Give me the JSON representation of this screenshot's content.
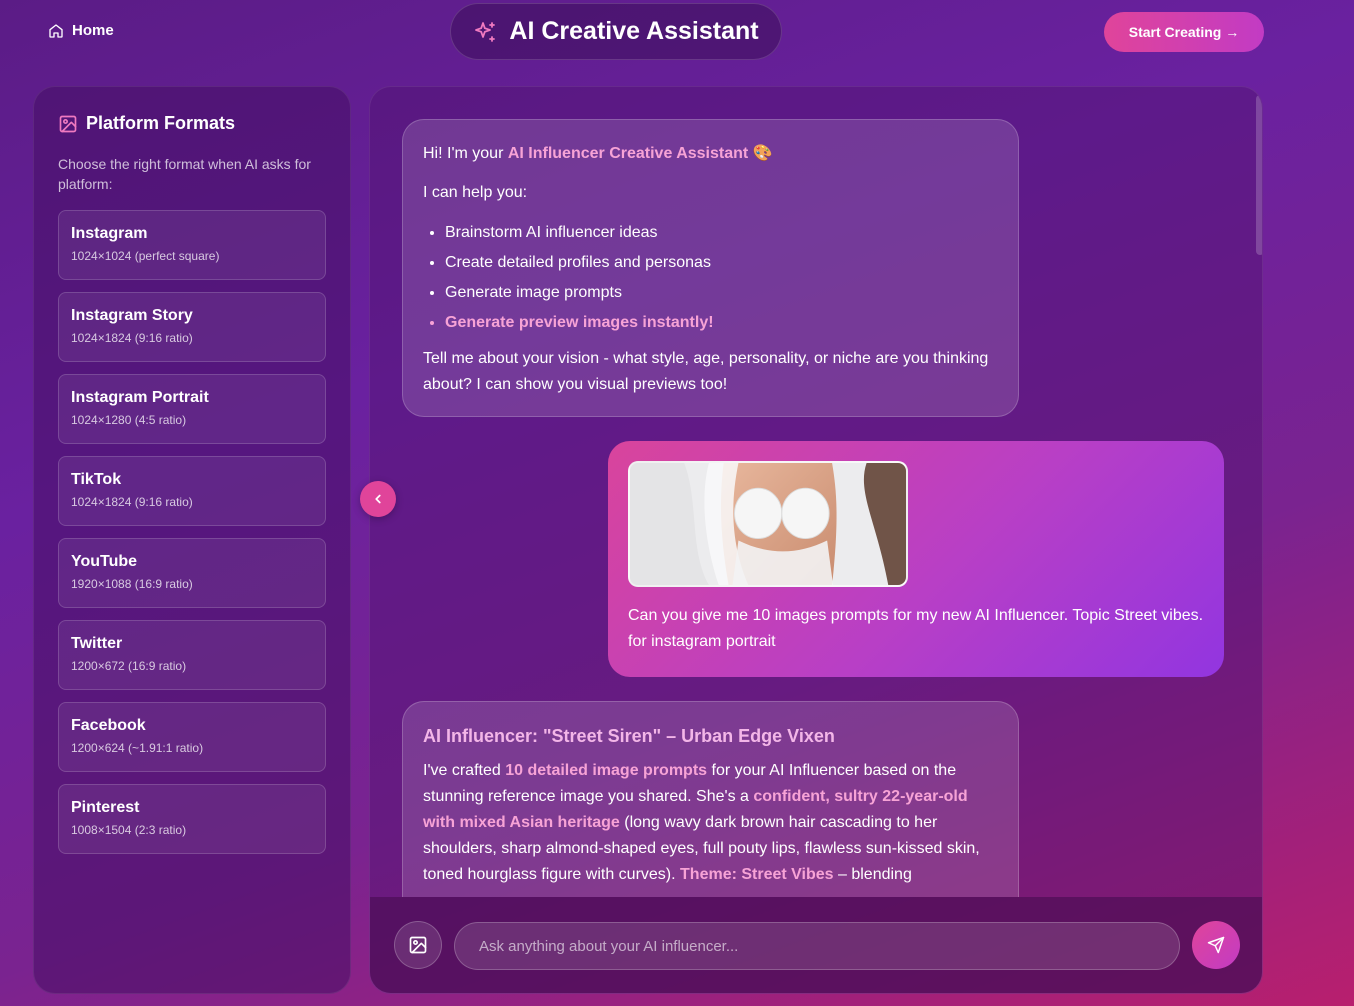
{
  "header": {
    "home_label": "Home",
    "app_title": "AI Creative Assistant",
    "start_label": "Start Creating →"
  },
  "sidebar": {
    "title": "Platform Formats",
    "description": "Choose the right format when AI asks for platform:",
    "formats": [
      {
        "name": "Instagram",
        "dims": "1024×1024 (perfect square)"
      },
      {
        "name": "Instagram Story",
        "dims": "1024×1824 (9:16 ratio)"
      },
      {
        "name": "Instagram Portrait",
        "dims": "1024×1280 (4:5 ratio)"
      },
      {
        "name": "TikTok",
        "dims": "1024×1824 (9:16 ratio)"
      },
      {
        "name": "YouTube",
        "dims": "1920×1088 (16:9 ratio)"
      },
      {
        "name": "Twitter",
        "dims": "1200×672 (16:9 ratio)"
      },
      {
        "name": "Facebook",
        "dims": "1200×624 (~1.91:1 ratio)"
      },
      {
        "name": "Pinterest",
        "dims": "1008×1504 (2:3 ratio)"
      }
    ]
  },
  "chat": {
    "greeting": {
      "prefix": "Hi! I'm your ",
      "highlight": "AI Influencer Creative Assistant",
      "emoji": "🎨",
      "help_line": "I can help you:",
      "items": [
        "Brainstorm AI influencer ideas",
        "Create detailed profiles and personas",
        "Generate image prompts"
      ],
      "highlight_item": "Generate preview images instantly!",
      "outro": "Tell me about your vision - what style, age, personality, or niche are you thinking about? I can show you visual previews too!"
    },
    "user_message": {
      "text": "Can you give me 10 images prompts for my new AI Influencer. Topic Street vibes. for instagram portrait"
    },
    "reply": {
      "title": "AI Influencer: \"Street Siren\" – Urban Edge Vixen",
      "p1": "I've crafted ",
      "h1": "10 detailed image prompts",
      "p2": " for your AI Influencer based on the stunning reference image you shared. She's a ",
      "h2": "confident, sultry 22-year-old with mixed Asian heritage",
      "p3": " (long wavy dark brown hair cascading to her shoulders, sharp almond-shaped eyes, full pouty lips, flawless sun-kissed skin, toned hourglass figure with curves). ",
      "h3": "Theme: Street Vibes",
      "p4": " – blending"
    },
    "input_placeholder": "Ask anything about your AI influencer..."
  },
  "colors": {
    "accent_pink": "#e0449a",
    "highlight_pink": "#f7a3d6",
    "title_lilac": "#f3b6e8"
  },
  "icons": [
    "home-icon",
    "sparkles-icon",
    "image-icon",
    "chevron-left-icon",
    "send-icon"
  ]
}
